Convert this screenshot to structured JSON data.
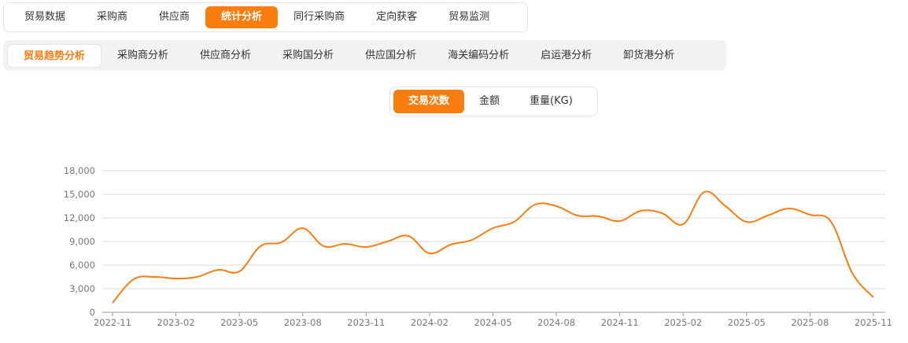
{
  "top_tabs": [
    {
      "label": "贸易数据",
      "active": false
    },
    {
      "label": "采购商",
      "active": false
    },
    {
      "label": "供应商",
      "active": false
    },
    {
      "label": "统计分析",
      "active": true
    },
    {
      "label": "同行采购商",
      "active": false
    },
    {
      "label": "定向获客",
      "active": false
    },
    {
      "label": "贸易监测",
      "active": false
    }
  ],
  "sub_tabs": [
    {
      "label": "贸易趋势分析",
      "active": true
    },
    {
      "label": "采购商分析",
      "active": false
    },
    {
      "label": "供应商分析",
      "active": false
    },
    {
      "label": "采购国分析",
      "active": false
    },
    {
      "label": "供应国分析",
      "active": false
    },
    {
      "label": "海关编码分析",
      "active": false
    },
    {
      "label": "启运港分析",
      "active": false
    },
    {
      "label": "卸货港分析",
      "active": false
    }
  ],
  "metric_tabs": [
    {
      "label": "交易次数",
      "active": true
    },
    {
      "label": "金额",
      "active": false
    },
    {
      "label": "重量(KG)",
      "active": false
    }
  ],
  "colors": {
    "accent": "#fa7d0f",
    "grid": "#d9d9d9",
    "axis_text": "#777777"
  },
  "chart_data": {
    "type": "line",
    "x": [
      "2022-11",
      "2022-12",
      "2023-01",
      "2023-02",
      "2023-03",
      "2023-04",
      "2023-05",
      "2023-06",
      "2023-07",
      "2023-08",
      "2023-09",
      "2023-10",
      "2023-11",
      "2023-12",
      "2024-01",
      "2024-02",
      "2024-03",
      "2024-04",
      "2024-05",
      "2024-06",
      "2024-07",
      "2024-08",
      "2024-09",
      "2024-10",
      "2024-11",
      "2024-12",
      "2025-01",
      "2025-02",
      "2025-03",
      "2025-04",
      "2025-05",
      "2025-06",
      "2025-07",
      "2025-08",
      "2025-09",
      "2025-10",
      "2025-11"
    ],
    "series": [
      {
        "values": [
          1200,
          4200,
          4500,
          4300,
          4500,
          5400,
          5200,
          8400,
          8900,
          10700,
          8400,
          8700,
          8300,
          9000,
          9700,
          7500,
          8600,
          9200,
          10700,
          11500,
          13700,
          13500,
          12300,
          12200,
          11600,
          12900,
          12600,
          11200,
          15300,
          13500,
          11500,
          12300,
          13200,
          12400,
          11500,
          5000,
          1900
        ]
      }
    ],
    "x_ticks": [
      "2022-11",
      "2023-02",
      "2023-05",
      "2023-08",
      "2023-11",
      "2024-02",
      "2024-05",
      "2024-08",
      "2024-11",
      "2025-02",
      "2025-05",
      "2025-08",
      "2025-11"
    ],
    "y_ticks": [
      "0",
      "3,000",
      "6,000",
      "9,000",
      "12,000",
      "15,000",
      "18,000"
    ],
    "ylim": [
      0,
      18000
    ],
    "grid": true
  }
}
